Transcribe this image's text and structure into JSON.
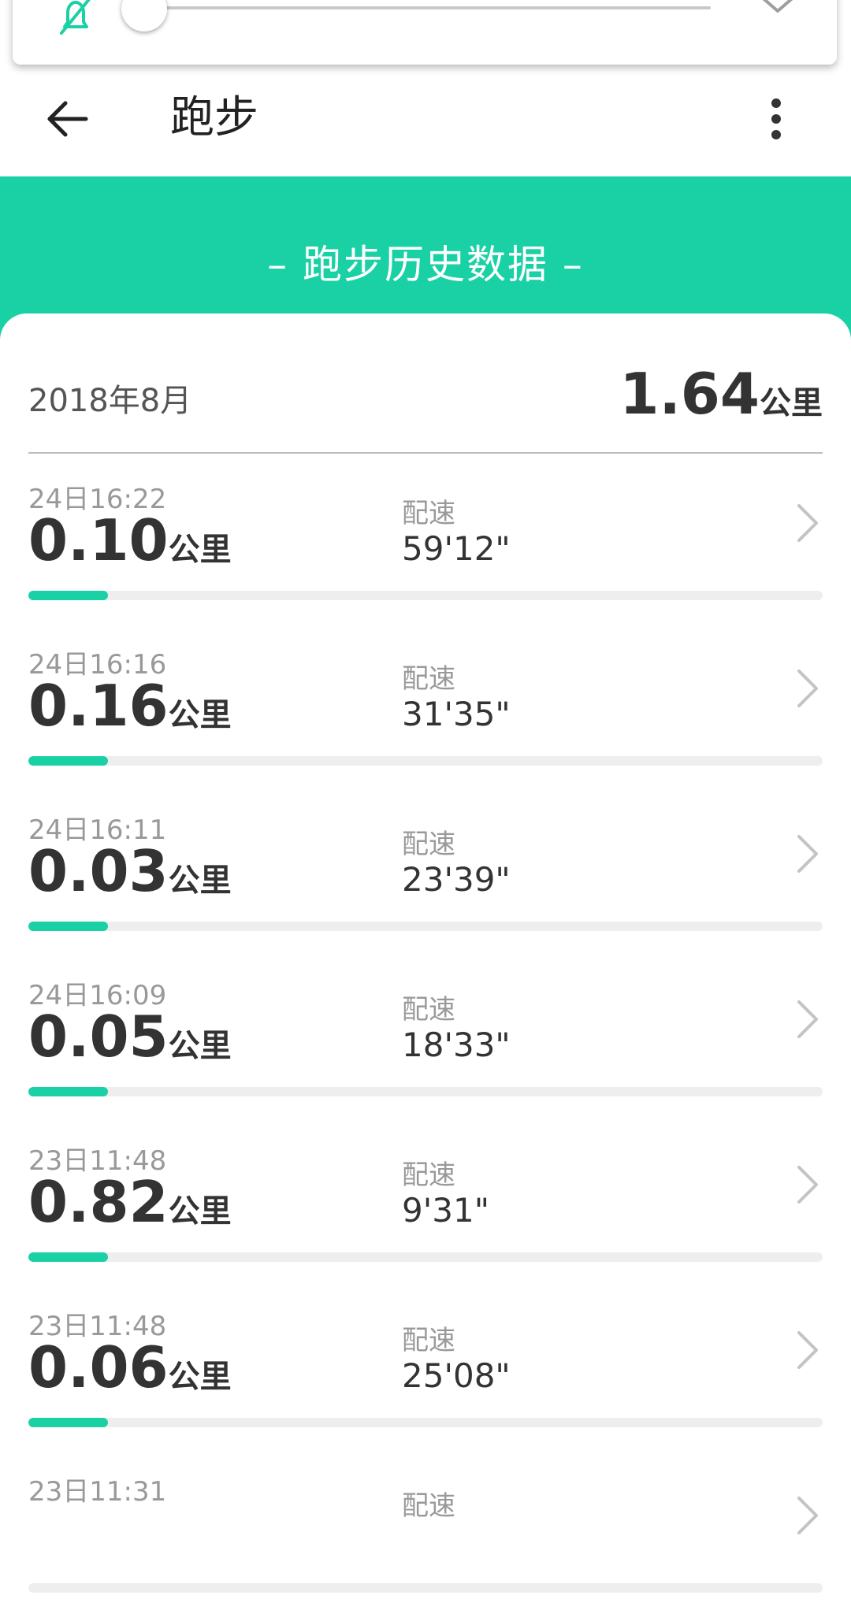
{
  "volume": {
    "level": 0.0
  },
  "app_bar": {
    "title": "跑步",
    "back_icon": "arrow-left-icon",
    "more_icon": "more-vertical-icon"
  },
  "banner": {
    "title": "– 跑步历史数据 –"
  },
  "summary": {
    "month": "2018年8月",
    "total": "1.64",
    "unit": "公里"
  },
  "records": [
    {
      "time": "24日16:22",
      "distance": "0.10",
      "unit": "公里",
      "pace_label": "配速",
      "pace": "59'12\"",
      "progress": 0.1
    },
    {
      "time": "24日16:16",
      "distance": "0.16",
      "unit": "公里",
      "pace_label": "配速",
      "pace": "31'35\"",
      "progress": 0.1
    },
    {
      "time": "24日16:11",
      "distance": "0.03",
      "unit": "公里",
      "pace_label": "配速",
      "pace": "23'39\"",
      "progress": 0.1
    },
    {
      "time": "24日16:09",
      "distance": "0.05",
      "unit": "公里",
      "pace_label": "配速",
      "pace": "18'33\"",
      "progress": 0.1
    },
    {
      "time": "23日11:48",
      "distance": "0.82",
      "unit": "公里",
      "pace_label": "配速",
      "pace": "9'31\"",
      "progress": 0.1
    },
    {
      "time": "23日11:48",
      "distance": "0.06",
      "unit": "公里",
      "pace_label": "配速",
      "pace": "25'08\"",
      "progress": 0.1
    },
    {
      "time": "23日11:31",
      "distance": "",
      "unit": "",
      "pace_label": "配速",
      "pace": "",
      "progress": 0
    }
  ],
  "colors": {
    "accent": "#1ad1a5",
    "text_primary": "#333333",
    "text_secondary": "#999999"
  }
}
